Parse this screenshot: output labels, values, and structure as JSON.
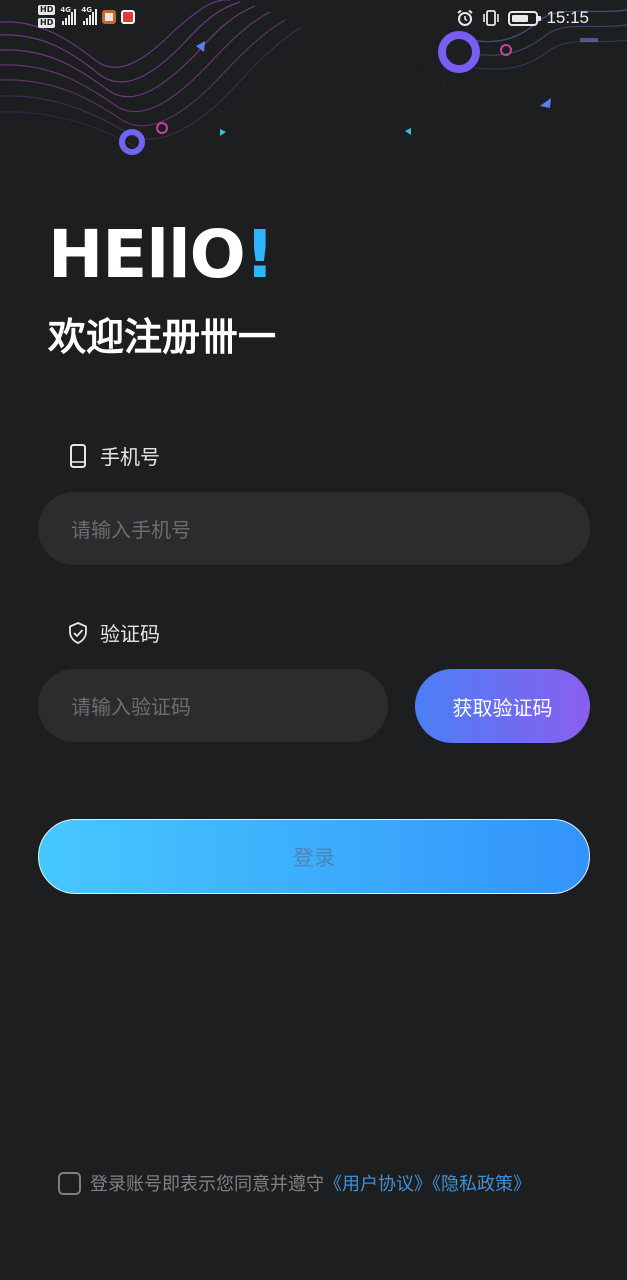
{
  "status_bar": {
    "time": "15:15",
    "network_1": "4G",
    "network_2": "4G",
    "hd_1": "HD",
    "hd_2": "HD",
    "battery_level": 0.75,
    "icons": [
      "hd-icon",
      "signal-icon",
      "signal-icon",
      "mail-app-icon",
      "red-app-icon",
      "alarm-icon",
      "vibrate-icon",
      "battery-icon"
    ]
  },
  "header": {
    "hello_main": "HEllO",
    "hello_excl": "!",
    "welcome": "欢迎注册卌一"
  },
  "phone": {
    "label": "手机号",
    "icon": "phone-icon",
    "placeholder": "请输入手机号"
  },
  "code": {
    "label": "验证码",
    "icon": "shield-check-icon",
    "placeholder": "请输入验证码",
    "button_label": "获取验证码"
  },
  "login": {
    "button_label": "登录"
  },
  "agreement": {
    "text": "登录账号即表示您同意并遵守",
    "user_agreement": "《用户协议》",
    "privacy_policy": "《隐私政策》",
    "checked": false
  },
  "colors": {
    "background": "#1d1e20",
    "accent": "#2fb4ff",
    "link": "#3f8fd6",
    "code_button_start": "#4a7ff5",
    "code_button_end": "#8a5ff0",
    "login_start": "#46c8fe",
    "login_end": "#3393fb"
  }
}
